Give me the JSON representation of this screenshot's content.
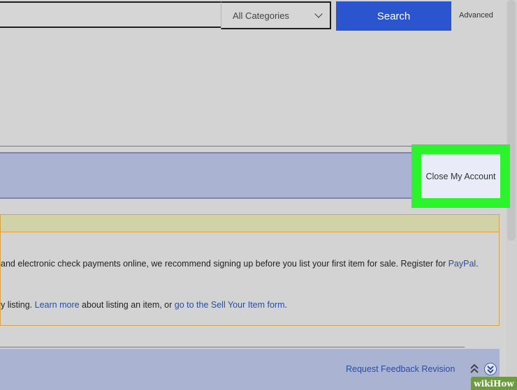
{
  "header": {
    "search_value": "",
    "category_selected": "All Categories",
    "search_label": "Search",
    "advanced_label": "Advanced"
  },
  "account": {
    "close_label": "Close My Account"
  },
  "notice": {
    "line1_text": "and electronic check payments online, we recommend signing up before you list your first item for sale. Register for ",
    "line1_link": "PayPal",
    "line1_end": ".",
    "line2_text": "y listing. ",
    "line2_link1": "Learn more",
    "line2_mid": " about listing an item, or ",
    "line2_link2": "go to the Sell Your Item form",
    "line2_end": "."
  },
  "footer": {
    "feedback_label": "Request Feedback Revision"
  },
  "watermark": {
    "text": "wikiHow"
  },
  "colors": {
    "search_button": "#2b54cf",
    "highlight": "#2cf42c",
    "bar": "#abb3d2",
    "link": "#2c4c9c"
  }
}
